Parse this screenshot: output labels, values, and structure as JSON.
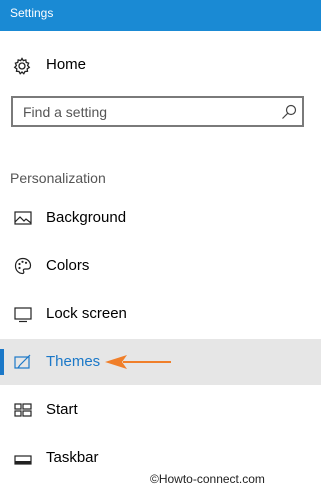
{
  "window": {
    "title": "Settings"
  },
  "home": {
    "label": "Home",
    "icon": "gear-icon"
  },
  "search": {
    "placeholder": "Find a setting",
    "icon": "search-icon"
  },
  "section": {
    "title": "Personalization"
  },
  "nav": {
    "items": [
      {
        "label": "Background",
        "icon": "image-icon"
      },
      {
        "label": "Colors",
        "icon": "palette-icon"
      },
      {
        "label": "Lock screen",
        "icon": "monitor-icon"
      },
      {
        "label": "Themes",
        "icon": "themes-brush-icon",
        "active": true
      },
      {
        "label": "Start",
        "icon": "start-tiles-icon"
      },
      {
        "label": "Taskbar",
        "icon": "taskbar-icon"
      }
    ]
  },
  "annotation": {
    "arrow_color": "#f07f2a"
  },
  "accent_color": "#1b78c8",
  "titlebar_color": "#1a8ad4",
  "watermark": {
    "text": "©Howto-connect.com"
  }
}
